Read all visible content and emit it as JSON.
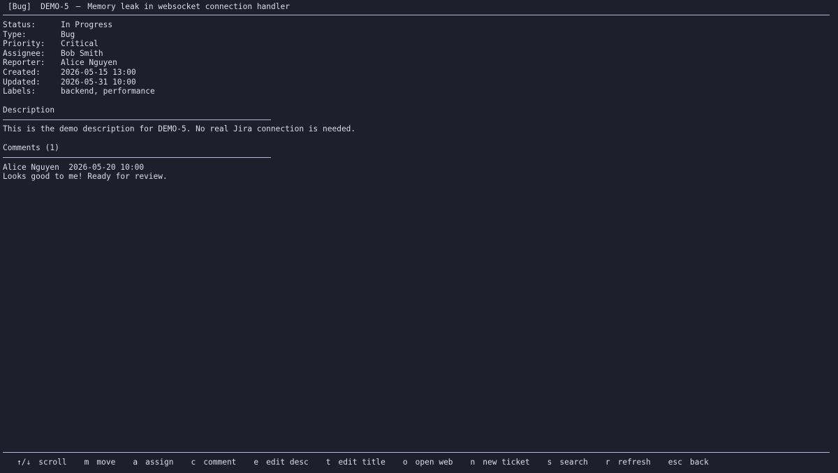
{
  "header": {
    "type_tag": "[Bug]",
    "key": "DEMO-5",
    "separator": "—",
    "title": "Memory leak in websocket connection handler"
  },
  "fields": [
    {
      "label": "Status:",
      "value": "In Progress"
    },
    {
      "label": "Type:",
      "value": "Bug"
    },
    {
      "label": "Priority:",
      "value": "Critical"
    },
    {
      "label": "Assignee:",
      "value": "Bob Smith"
    },
    {
      "label": "Reporter:",
      "value": "Alice Nguyen"
    },
    {
      "label": "Created:",
      "value": "2026-05-15 13:00"
    },
    {
      "label": "Updated:",
      "value": "2026-05-31 10:00"
    },
    {
      "label": "Labels:",
      "value": "backend, performance"
    }
  ],
  "description": {
    "title": "Description",
    "text": "This is the demo description for DEMO-5. No real Jira connection is needed."
  },
  "comments": {
    "title": "Comments (1)",
    "items": [
      {
        "author_line": "Alice Nguyen  2026-05-20 10:00",
        "body": "Looks good to me! Ready for review."
      }
    ]
  },
  "footer": {
    "keys": [
      {
        "key": "↑/↓",
        "label": "scroll"
      },
      {
        "key": "m",
        "label": "move"
      },
      {
        "key": "a",
        "label": "assign"
      },
      {
        "key": "c",
        "label": "comment"
      },
      {
        "key": "e",
        "label": "edit desc"
      },
      {
        "key": "t",
        "label": "edit title"
      },
      {
        "key": "o",
        "label": "open web"
      },
      {
        "key": "n",
        "label": "new ticket"
      },
      {
        "key": "s",
        "label": "search"
      },
      {
        "key": "r",
        "label": "refresh"
      },
      {
        "key": "esc",
        "label": "back"
      }
    ]
  },
  "colors": {
    "background": "#1e1e2c",
    "text": "#dcdde6",
    "rule": "#b7b8dc"
  }
}
